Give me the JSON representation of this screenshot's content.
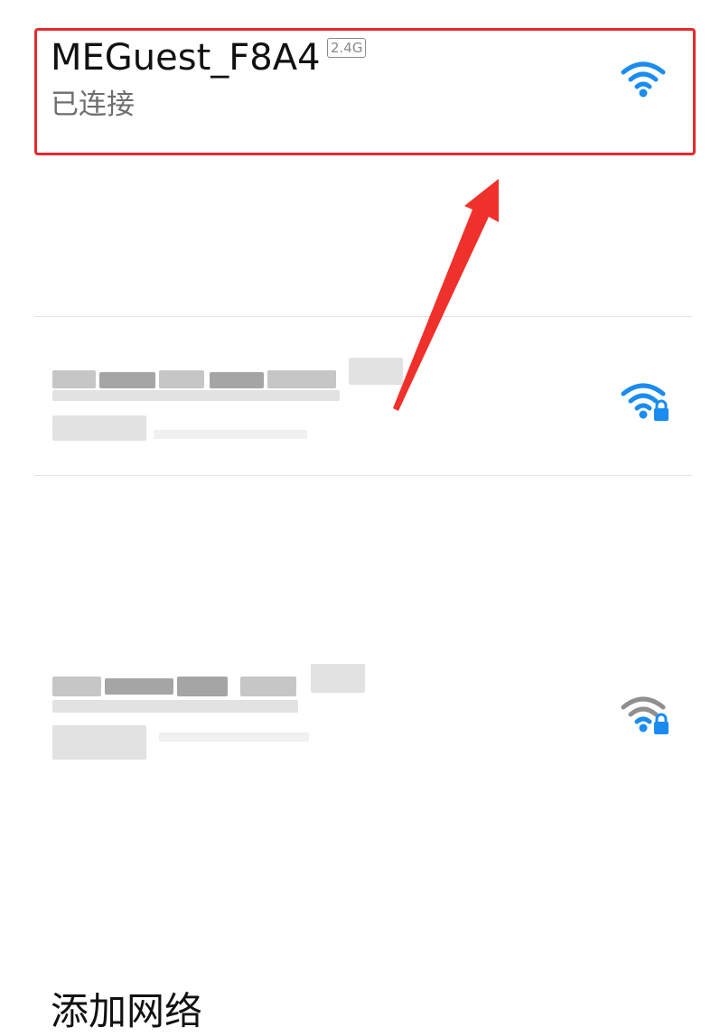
{
  "networks": {
    "connected": {
      "ssid": "MEGuest_F8A4",
      "band": "2.4G",
      "status": "已连接",
      "signal_icon": "wifi-full-icon",
      "signal_color": "#1a8cf0"
    },
    "others": [
      {
        "ssid": "",
        "secured": true,
        "signal_icon": "wifi-lock-icon",
        "signal_color": "#1a8cf0"
      },
      {
        "ssid": "",
        "secured": true,
        "signal_icon": "wifi-lock-icon",
        "signal_color": "#8f8f8f"
      }
    ]
  },
  "actions": {
    "add_network_label": "添加网络"
  },
  "annotation": {
    "highlight_color": "#e8292d"
  }
}
